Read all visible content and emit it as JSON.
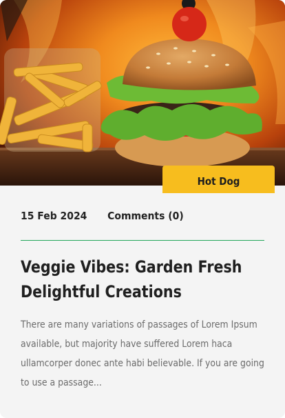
{
  "post": {
    "category": "Hot Dog",
    "date": "15 Feb 2024",
    "comments": "Comments (0)",
    "title_lines": [
      "Veggie Vibes: Garden Fresh",
      "Delightful Creations"
    ],
    "excerpt_lines": [
      "There are many variations of passages of Lorem Ipsum",
      "available, but majority have suffered Lorem haca",
      "ullamcorper donec ante habi believable. If you are going",
      "to use a passage..."
    ]
  },
  "image": {
    "subject": "burger-with-fries-photo"
  },
  "colors": {
    "accent": "#f7bd1e",
    "divider": "#21a55a",
    "card_bg": "#f4f4f4",
    "title": "#1f1f1f",
    "text": "#6b6b6b"
  }
}
